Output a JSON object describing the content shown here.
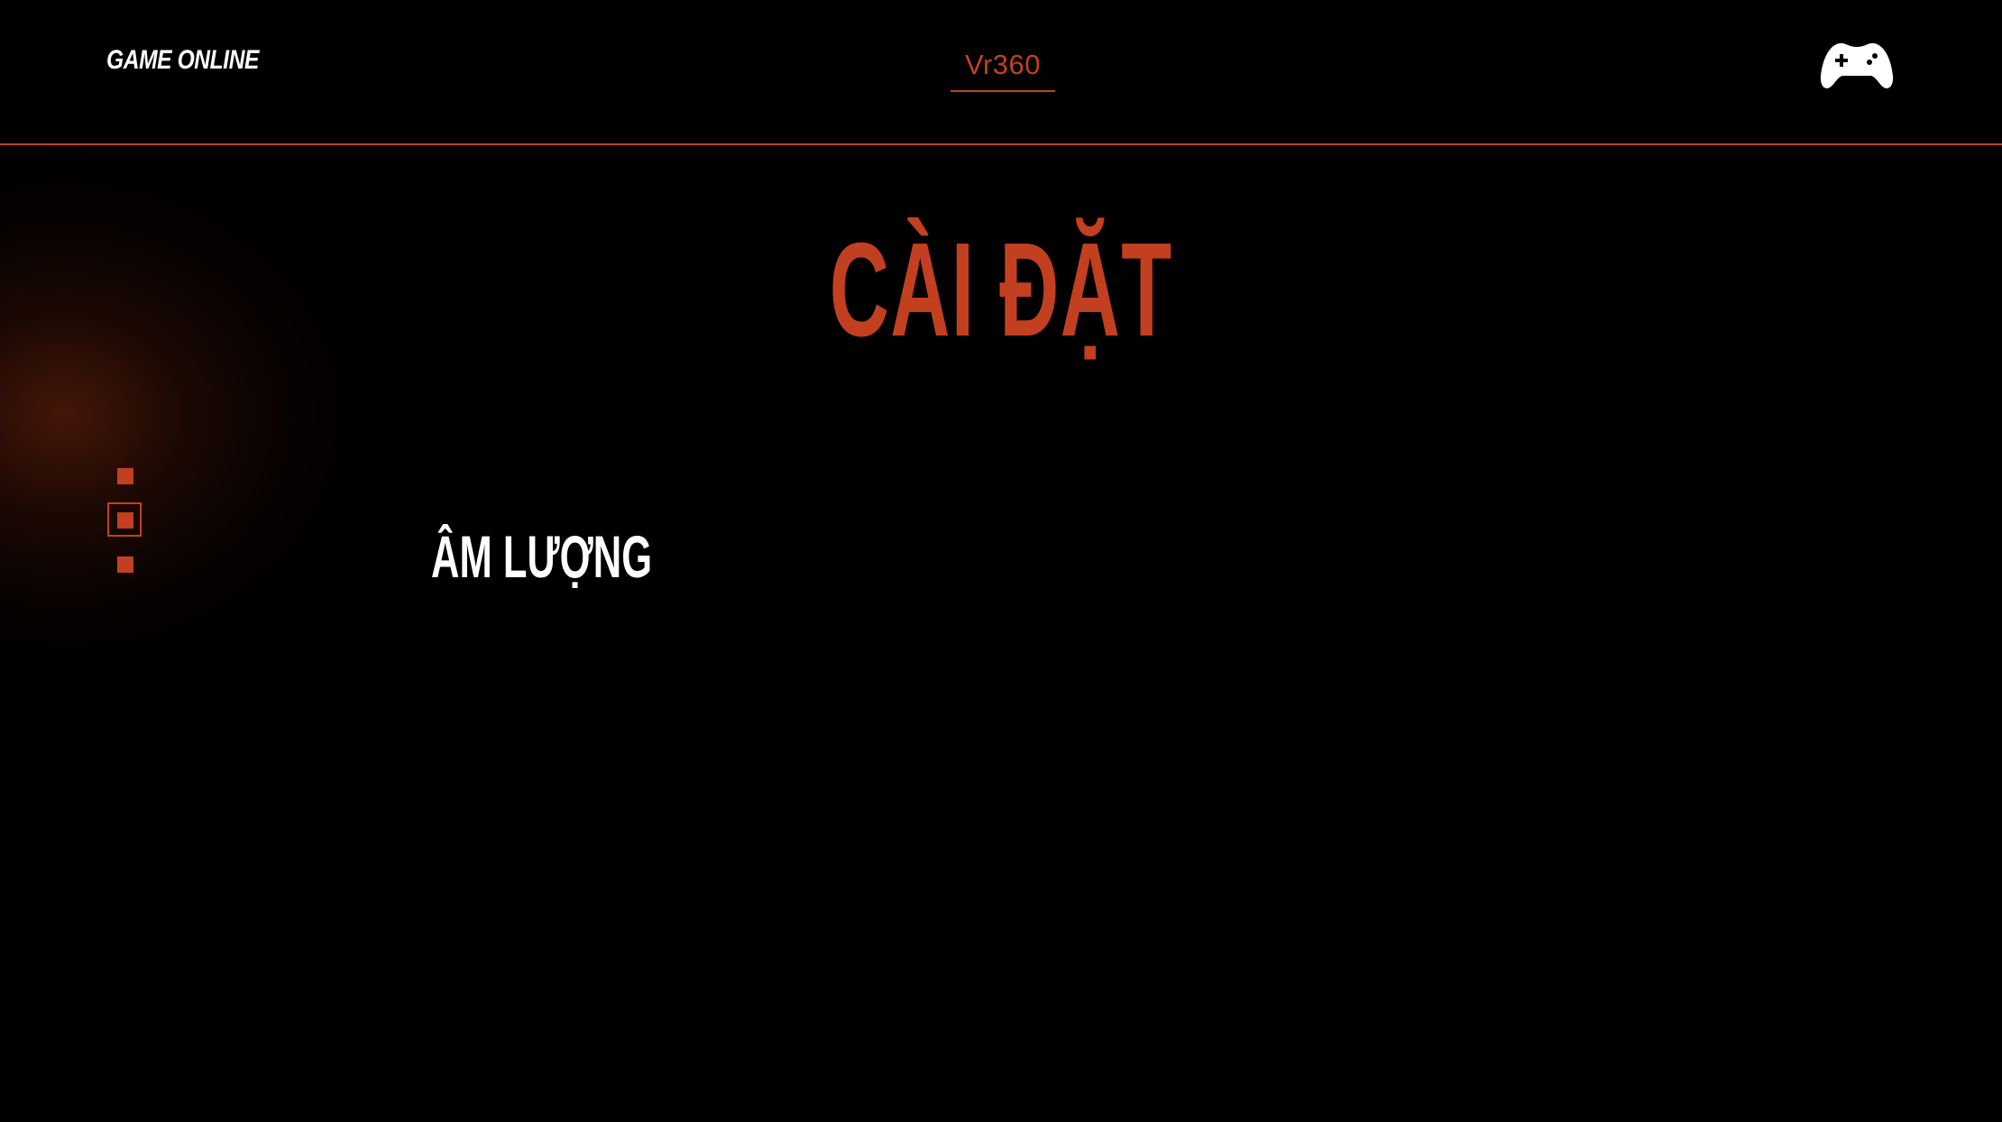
{
  "header": {
    "brand": "GAME ONLINE",
    "nav_tab": "Vr360",
    "controller_icon": "gamepad-icon"
  },
  "main": {
    "title": "CÀI ĐẶT",
    "settings": [
      {
        "label": "ÂM LƯỢNG"
      }
    ]
  },
  "pager": {
    "count": 3,
    "active_index": 1,
    "icon": "square-bullet-icon"
  },
  "colors": {
    "accent": "#c2401f",
    "background": "#000000",
    "text": "#ffffff"
  }
}
